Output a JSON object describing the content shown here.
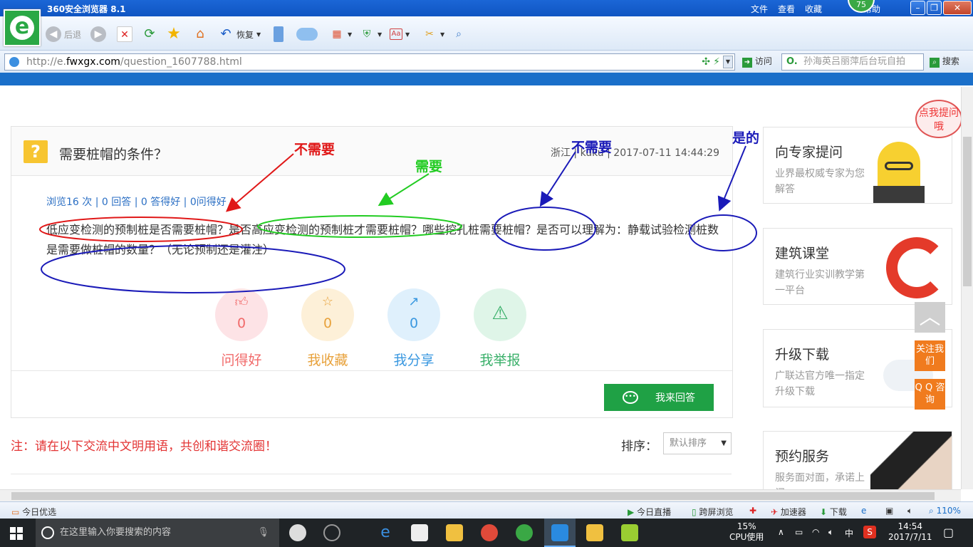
{
  "browser": {
    "title": "360安全浏览器 8.1",
    "menu": [
      "文件",
      "查看",
      "收藏",
      "帮助"
    ],
    "badge": "75",
    "back_label": "后退",
    "restore_label": "恢复",
    "url_prefix": "http://e.",
    "url_domain": "fwxgx.com",
    "url_path": "/question_1607788.html",
    "visit_label": "访问",
    "search_placeholder": "孙海英吕丽萍后台玩自拍",
    "search_label": "搜索"
  },
  "question": {
    "title": "需要桩帽的条件？",
    "meta": "浙江 | kuku | 2017-07-11 14:44:29",
    "stats": "浏览16 次 | 0 回答 | 0 答得好 | 0问得好",
    "body": "低应变检测的预制桩是否需要桩帽？是否高应变检测的预制桩才需要桩帽？哪些挖孔桩需要桩帽？是否可以理解为：静载试验检测桩数是需要做桩帽的数量？（无论预制还是灌注）",
    "actions": [
      {
        "label": "问得好",
        "count": "0",
        "color": "#f16a6a",
        "bg": "#fde3e6"
      },
      {
        "label": "我收藏",
        "count": "0",
        "color": "#e8a23c",
        "bg": "#fdf0d8"
      },
      {
        "label": "我分享",
        "count": "0",
        "color": "#3a98e0",
        "bg": "#dff0fc"
      },
      {
        "label": "我举报",
        "count": "0",
        "color": "#3ab06a",
        "bg": "#dff5e8"
      }
    ],
    "answer_button": "我来回答"
  },
  "comments": {
    "notice": "注：请在以下交流中文明用语，共创和谐交流圈！",
    "sort_label": "排序：",
    "sort_value": "默认排序"
  },
  "sidebar": {
    "bubble": "点我提问哦",
    "cards": [
      {
        "title": "向专家提问",
        "desc": "业界最权威专家为您解答"
      },
      {
        "title": "建筑课堂",
        "desc": "建筑行业实训教学第一平台"
      },
      {
        "title": "升级下载",
        "desc": "广联达官方唯一指定升级下载"
      },
      {
        "title": "预约服务",
        "desc": "服务面对面，承诺上门"
      }
    ],
    "follow": "关注我们",
    "qq": "Q Q 咨询"
  },
  "annotations": [
    {
      "text": "不需要",
      "color": "#e01818"
    },
    {
      "text": "需要",
      "color": "#22cc22"
    },
    {
      "text": "不需要",
      "color": "#1a1ab8"
    },
    {
      "text": "是的",
      "color": "#1a1ab8"
    }
  ],
  "statusbar": {
    "left": "今日优选",
    "live": "今日直播",
    "cross": "跨屏浏览",
    "accelerator": "加速器",
    "download": "下载",
    "zoom": "110%"
  },
  "taskbar": {
    "search_placeholder": "在这里输入你要搜索的内容",
    "cpu_percent": "15%",
    "cpu_label": "CPU使用",
    "ime": "中",
    "time": "14:54",
    "date": "2017/7/11"
  }
}
